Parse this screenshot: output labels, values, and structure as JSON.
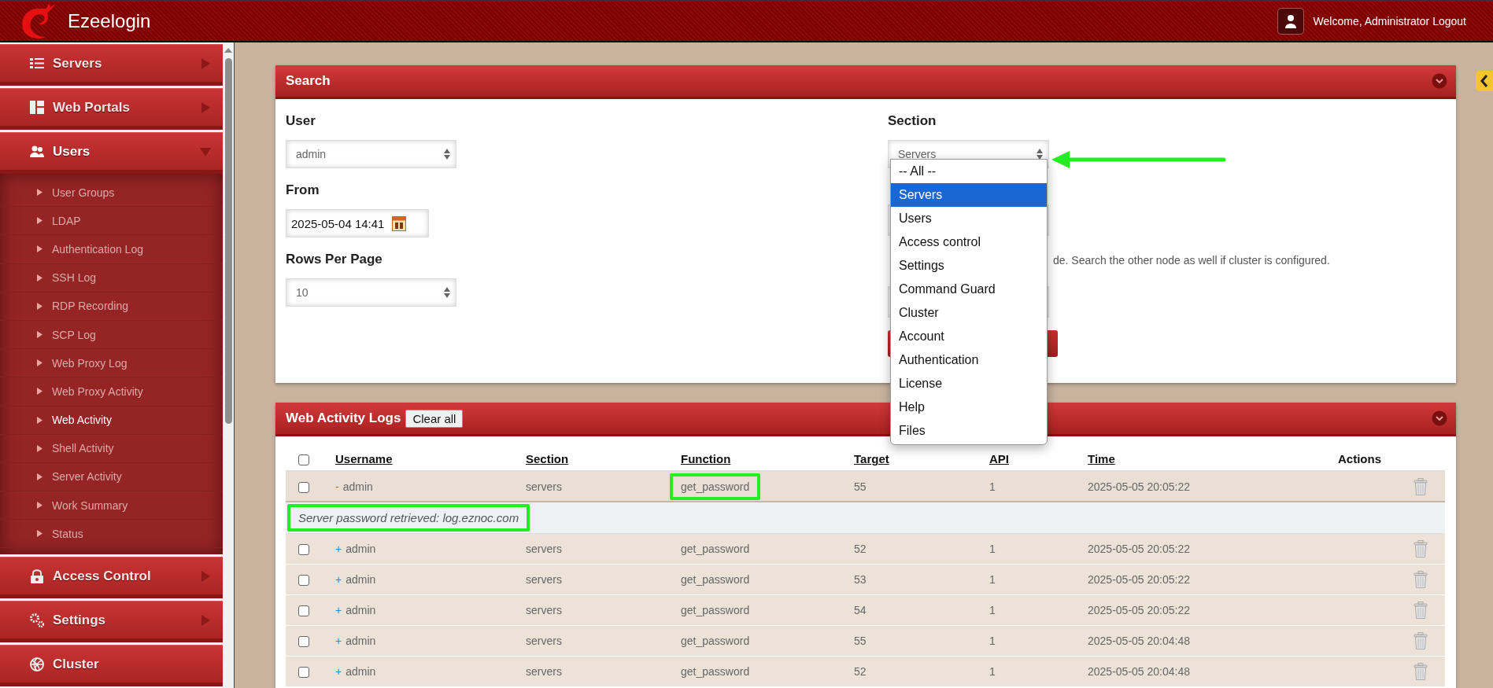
{
  "header": {
    "app_name": "Ezeelogin",
    "welcome": "Welcome, Administrator",
    "logout": "Logout"
  },
  "sidebar": {
    "items": [
      {
        "label": "Servers",
        "expandable": true,
        "expanded": false
      },
      {
        "label": "Web Portals",
        "expandable": true,
        "expanded": false
      },
      {
        "label": "Users",
        "expandable": true,
        "expanded": true,
        "children": [
          {
            "label": "User Groups",
            "selected": false
          },
          {
            "label": "LDAP",
            "selected": false
          },
          {
            "label": "Authentication Log",
            "selected": false
          },
          {
            "label": "SSH Log",
            "selected": false
          },
          {
            "label": "RDP Recording",
            "selected": false
          },
          {
            "label": "SCP Log",
            "selected": false
          },
          {
            "label": "Web Proxy Log",
            "selected": false
          },
          {
            "label": "Web Proxy Activity",
            "selected": false
          },
          {
            "label": "Web Activity",
            "selected": true
          },
          {
            "label": "Shell Activity",
            "selected": false
          },
          {
            "label": "Server Activity",
            "selected": false
          },
          {
            "label": "Work Summary",
            "selected": false
          },
          {
            "label": "Status",
            "selected": false
          }
        ]
      },
      {
        "label": "Access Control",
        "expandable": true,
        "expanded": false
      },
      {
        "label": "Settings",
        "expandable": true,
        "expanded": false
      },
      {
        "label": "Cluster",
        "expandable": false,
        "expanded": false
      }
    ]
  },
  "search": {
    "title": "Search",
    "fields": [
      {
        "label": "User",
        "kind": "select",
        "value": "admin"
      },
      {
        "label": "From",
        "kind": "date",
        "value": "2025-05-04 14:41"
      },
      {
        "label": "Rows Per Page",
        "kind": "select",
        "value": "10"
      }
    ],
    "section": {
      "label": "Section",
      "value": "Servers",
      "open": true,
      "pointer_arrow": true,
      "options": [
        {
          "label": "-- All --",
          "selected": false
        },
        {
          "label": "Servers",
          "selected": true
        },
        {
          "label": "Users",
          "selected": false
        },
        {
          "label": "Access control",
          "selected": false
        },
        {
          "label": "Settings",
          "selected": false
        },
        {
          "label": "Command Guard",
          "selected": false
        },
        {
          "label": "Cluster",
          "selected": false
        },
        {
          "label": "Account",
          "selected": false
        },
        {
          "label": "Authentication",
          "selected": false
        },
        {
          "label": "License",
          "selected": false
        },
        {
          "label": "Help",
          "selected": false
        },
        {
          "label": "Files",
          "selected": false
        }
      ]
    },
    "note": "de. Search the other node as well if cluster is configured."
  },
  "logs": {
    "title": "Web Activity Logs",
    "clear_button": "Clear all",
    "select_all_checked": false,
    "columns": [
      {
        "label": "Username",
        "sortable": true
      },
      {
        "label": "Section",
        "sortable": true
      },
      {
        "label": "Function",
        "sortable": true
      },
      {
        "label": "Target",
        "sortable": true
      },
      {
        "label": "API",
        "sortable": true
      },
      {
        "label": "Time",
        "sortable": true
      },
      {
        "label": "Actions",
        "sortable": false
      }
    ],
    "rows": [
      {
        "checked": false,
        "toggle": "-",
        "expanded": true,
        "username": "admin",
        "section": "servers",
        "function": "get_password",
        "target": "55",
        "api": "1",
        "time": "2025-05-05 20:05:22",
        "detail": "Server password retrieved: log.eznoc.com",
        "highlight_function": true,
        "highlight_detail": true
      },
      {
        "checked": false,
        "toggle": "+",
        "expanded": false,
        "username": "admin",
        "section": "servers",
        "function": "get_password",
        "target": "52",
        "api": "1",
        "time": "2025-05-05 20:05:22"
      },
      {
        "checked": false,
        "toggle": "+",
        "expanded": false,
        "username": "admin",
        "section": "servers",
        "function": "get_password",
        "target": "53",
        "api": "1",
        "time": "2025-05-05 20:05:22"
      },
      {
        "checked": false,
        "toggle": "+",
        "expanded": false,
        "username": "admin",
        "section": "servers",
        "function": "get_password",
        "target": "54",
        "api": "1",
        "time": "2025-05-05 20:05:22"
      },
      {
        "checked": false,
        "toggle": "+",
        "expanded": false,
        "username": "admin",
        "section": "servers",
        "function": "get_password",
        "target": "55",
        "api": "1",
        "time": "2025-05-05 20:04:48"
      },
      {
        "checked": false,
        "toggle": "+",
        "expanded": false,
        "username": "admin",
        "section": "servers",
        "function": "get_password",
        "target": "52",
        "api": "1",
        "time": "2025-05-05 20:04:48"
      }
    ]
  }
}
